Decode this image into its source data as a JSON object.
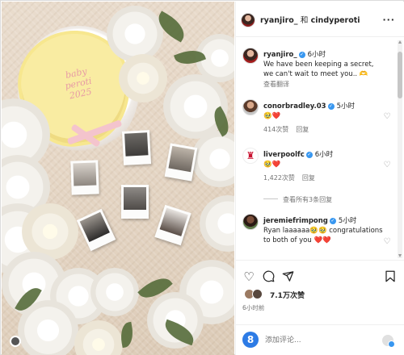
{
  "post": {
    "header": {
      "author": "ryanjiro_",
      "conjunction": "和",
      "coauthor": "cindyperoti",
      "more_label": "···"
    },
    "photo": {
      "cake_text": "baby\nperoti\n2025",
      "alt": "Post photo"
    },
    "caption": {
      "username": "ryanjiro_",
      "time": "6小时",
      "text": "We have been keeping a secret, we can't wait to meet you.. 🫶",
      "translate": "查看翻译"
    },
    "comments": [
      {
        "username": "conorbradley.03",
        "time": "5小时",
        "text": "🥹❤️",
        "likes": "414次赞",
        "reply": "回复"
      },
      {
        "username": "liverpoolfc",
        "time": "6小时",
        "text": "🥹❤️",
        "likes": "1,422次赞",
        "reply": "回复",
        "view_replies": "查看所有3条回复"
      },
      {
        "username": "jeremiefrimpong",
        "time": "5小时",
        "text": "Ryan laaaaaa🥹🥹 congratulations to both of you ❤️❤️",
        "likes": "",
        "reply": ""
      }
    ],
    "actions": {
      "like_icon": "heart-outline-icon",
      "comment_icon": "comment-icon",
      "share_icon": "send-icon",
      "save_icon": "bookmark-icon",
      "likes_count": "7.1万次赞",
      "posted_ago": "6小时前"
    },
    "composer": {
      "placeholder": "添加评论..."
    },
    "colors": {
      "verified": "#3897f0",
      "heart": "#e0284f",
      "muted": "#737373"
    }
  }
}
